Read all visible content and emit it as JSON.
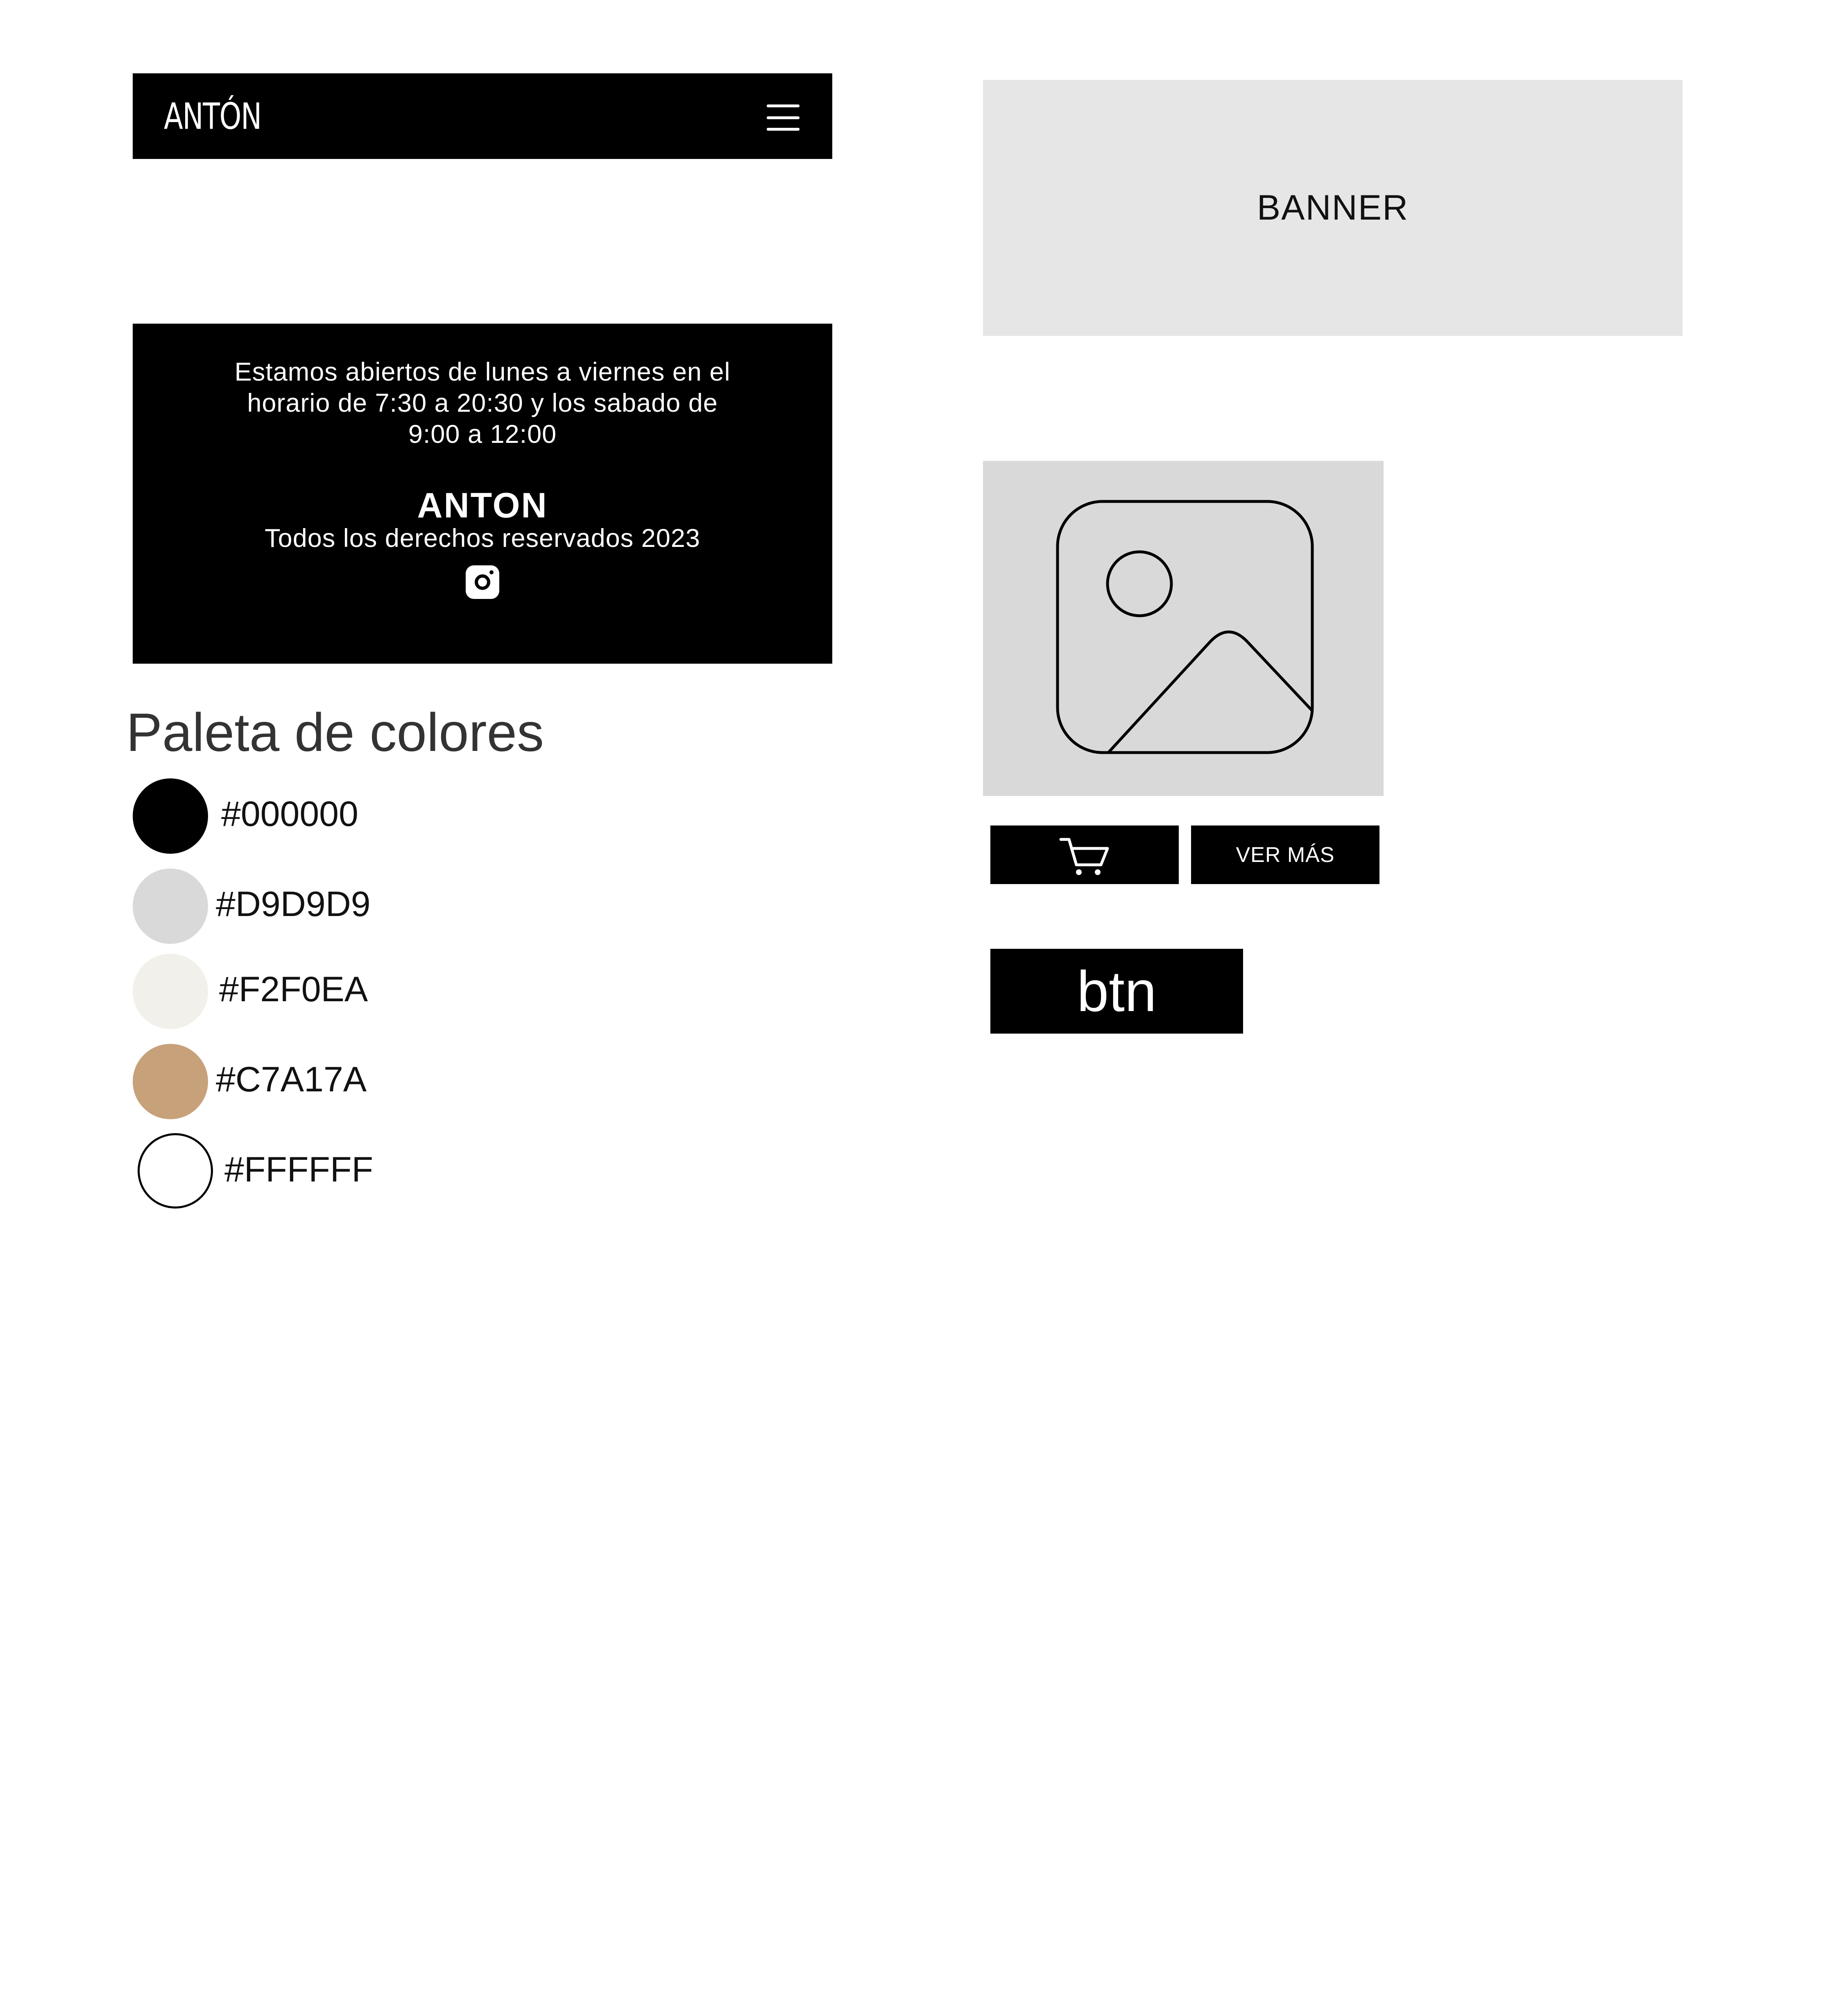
{
  "navbar": {
    "logo_text": "ANTÓN",
    "menu_icon": "hamburger-menu-icon"
  },
  "footer": {
    "hours_text": "Estamos abiertos de lunes a viernes en el\nhorario de 7:30 a 20:30 y los sabado de\n9:00 a 12:00",
    "brand": "ANTON",
    "rights": "Todos los derechos reservados 2023",
    "social_icon": "instagram-icon"
  },
  "palette": {
    "title": "Paleta de colores",
    "colors": [
      {
        "label": "#000000",
        "hex": "#000000"
      },
      {
        "label": "#D9D9D9",
        "hex": "#D9D9D9"
      },
      {
        "label": "#F2F0EA",
        "hex": "#F2F0EA"
      },
      {
        "label": "#C7A17A",
        "hex": "#C7A17A"
      },
      {
        "label": "#FFFFFF",
        "hex": "#FFFFFF"
      }
    ]
  },
  "banner": {
    "label": "BANNER"
  },
  "product_card": {
    "image_icon": "image-placeholder-icon",
    "cart_icon": "shopping-cart-icon",
    "more_label": "VER MÁS"
  },
  "sample_button": {
    "label": "btn"
  }
}
